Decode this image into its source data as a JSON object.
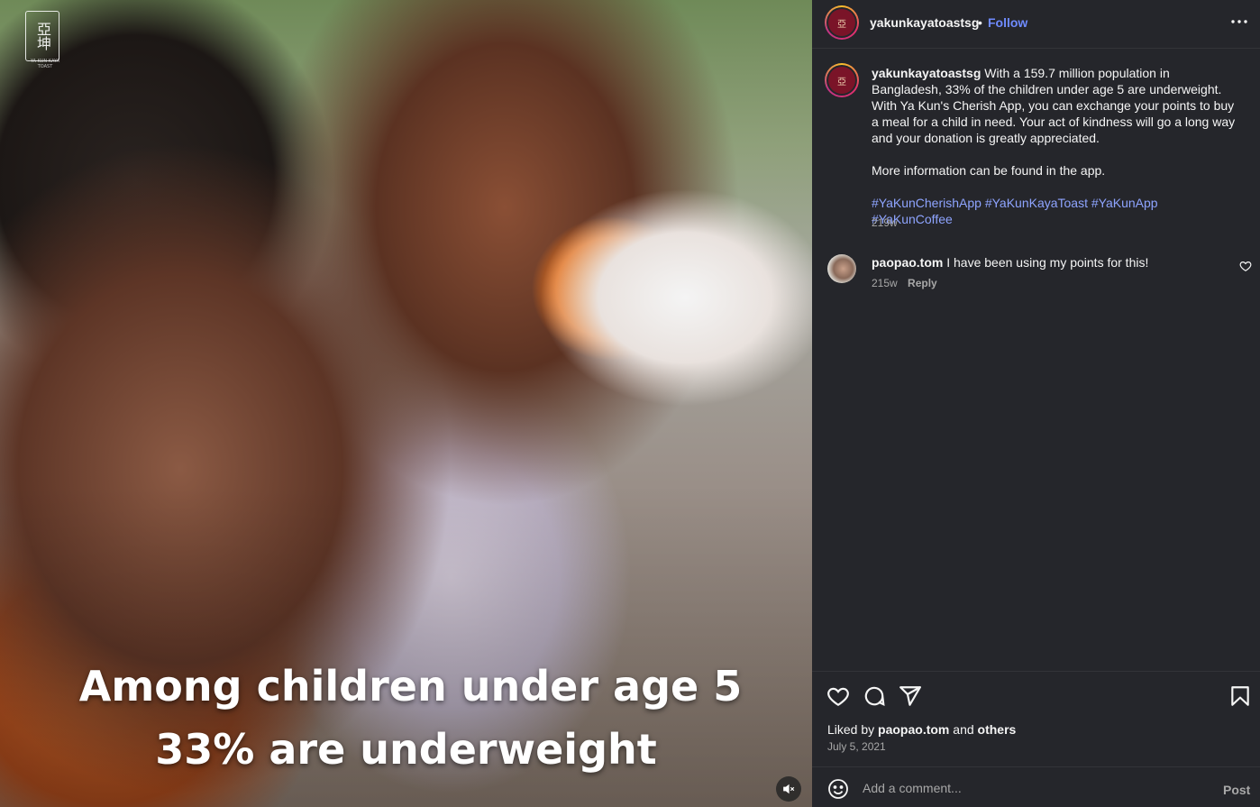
{
  "media": {
    "brand_mark_glyphs": "亞坤",
    "brand_mark_sub": "YA KUN KAYA TOAST",
    "caption_line1": "Among children under age 5",
    "caption_line2": "33% are underweight",
    "mute_icon": "speaker-muted-icon"
  },
  "header": {
    "username": "yakunkayatoastsg",
    "separator": "•",
    "follow_label": "Follow",
    "more_icon": "more-horizontal-icon"
  },
  "caption": {
    "username": "yakunkayatoastsg",
    "text": "With a 159.7 million population in Bangladesh, 33% of the children under age 5 are underweight. With Ya Kun's Cherish App, you can exchange your points to buy a meal for a child in need. Your act of kindness will go a long way and your donation is greatly appreciated.",
    "more_info": "More information can be found in the app.",
    "hashtags": [
      "#YaKunCherishApp",
      "#YaKunKayaToast",
      "#YaKunApp",
      "#YaKunCoffee"
    ],
    "age": "219w"
  },
  "comments": [
    {
      "username": "paopao.tom",
      "text": "I have been using my points for this!",
      "age": "215w",
      "reply_label": "Reply"
    }
  ],
  "actions": {
    "liked_by_prefix": "Liked by",
    "liked_by_user": "paopao.tom",
    "liked_by_and": "and",
    "liked_by_others": "others",
    "date": "July 5, 2021"
  },
  "comment_box": {
    "placeholder": "Add a comment...",
    "post_label": "Post"
  },
  "colors": {
    "panel_bg": "#25262b",
    "link_blue": "#6f8bff",
    "hashtag_blue": "#8ea4ff",
    "muted_text": "#a8a8a8"
  }
}
